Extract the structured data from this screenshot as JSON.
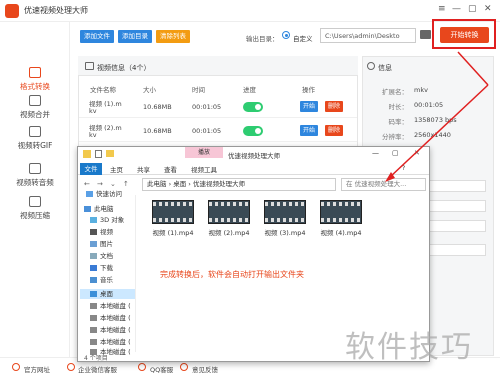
{
  "app": {
    "title": "优速视频处理大师",
    "win_minimize": "—",
    "win_restore": "▢",
    "win_close": "✕",
    "win_menu": "≡"
  },
  "sidebar": {
    "items": [
      {
        "label": "格式转换",
        "active": true
      },
      {
        "label": "视频合并"
      },
      {
        "label": "视频转GIF"
      },
      {
        "label": "视频转音频"
      },
      {
        "label": "视频压缩"
      }
    ]
  },
  "toolbar": {
    "add_file": "添加文件",
    "add_dir": "添加目录",
    "clear_list": "清除列表",
    "output_label": "输出目录：",
    "custom_option": "自定义",
    "output_path": "C:\\Users\\admin\\Deskto",
    "start_button": "开始转换"
  },
  "list": {
    "title": "视频信息（4个）",
    "columns": [
      "文件名称",
      "大小",
      "时间",
      "进度",
      "操作"
    ],
    "rows": [
      {
        "name1": "视频 (1).m",
        "name2": "kv",
        "size": "10.68MB",
        "time": "00:01:05",
        "start": "开始",
        "delete": "删除"
      },
      {
        "name1": "视频 (2).m",
        "name2": "kv",
        "size": "10.68MB",
        "time": "00:01:05",
        "start": "开始",
        "delete": "删除"
      }
    ]
  },
  "info": {
    "title": "信息",
    "fields": [
      {
        "k": "扩展名：",
        "v": "mkv"
      },
      {
        "k": "时长：",
        "v": "00:01:05"
      },
      {
        "k": "码率：",
        "v": "1358073 bps"
      },
      {
        "k": "分辨率：",
        "v": "2560x1440"
      }
    ]
  },
  "footer": {
    "items": [
      "官方网址",
      "企业微信客服",
      "QQ客服",
      "意见反馈"
    ]
  },
  "explorer": {
    "context_tab": "播放",
    "title": "优速视频处理大师",
    "ribbon": [
      "文件",
      "主页",
      "共享",
      "查看",
      "视频工具"
    ],
    "address": "此电脑 › 桌面 › 优速视频处理大师",
    "search_placeholder": "在 优速视频处理大...",
    "tree": [
      "快速访问",
      "3D 对象",
      "视频",
      "图片",
      "文档",
      "下载",
      "音乐",
      "桌面",
      "本地磁盘 (",
      "本地磁盘 (",
      "本地磁盘 (",
      "本地磁盘 (",
      "本地磁盘 ("
    ],
    "tree_header": "此电脑",
    "files": [
      "视频 (1).mp4",
      "视频 (2).mp4",
      "视频 (3).mp4",
      "视频 (4).mp4"
    ],
    "status": "4 个项目"
  },
  "tip": "完成转换后，软件会自动打开输出文件夹",
  "watermark": "软件技巧",
  "colors": {
    "accent": "#e8471c",
    "blue": "#2e86de",
    "toggle": "#2ecc71",
    "highlight": "#e02020"
  }
}
